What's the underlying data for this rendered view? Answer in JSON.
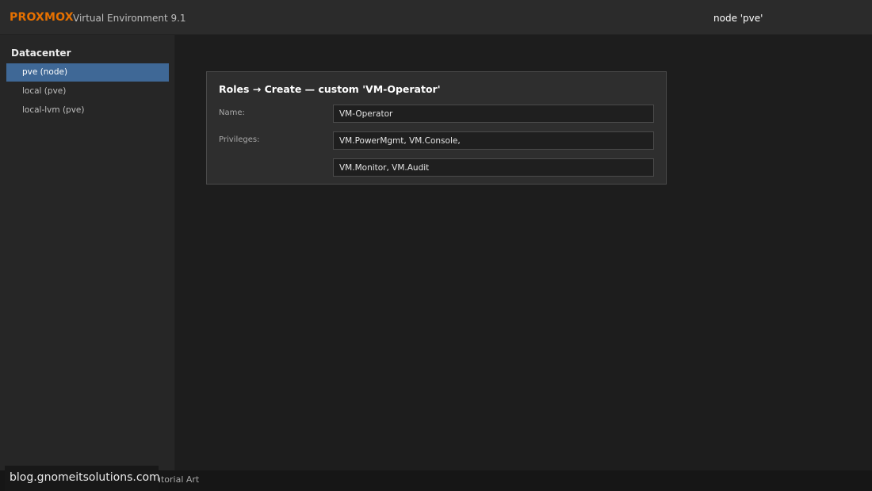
{
  "header": {
    "brand": "PROXMOX",
    "product": "Virtual Environment 9.1",
    "node": "node 'pve'"
  },
  "sidebar": {
    "title": "Datacenter",
    "items": [
      {
        "label": "pve (node)",
        "selected": true
      },
      {
        "label": "local (pve)",
        "selected": false
      },
      {
        "label": "local-lvm (pve)",
        "selected": false
      }
    ]
  },
  "dialog": {
    "title": "Roles → Create — custom 'VM-Operator'",
    "name_label": "Name:",
    "name_value": "VM-Operator",
    "privileges_label": "Privileges:",
    "privileges_line1": "VM.PowerMgmt, VM.Console,",
    "privileges_line2": "VM.Monitor, VM.Audit"
  },
  "footer": {
    "text": "utorial Art"
  },
  "watermark": {
    "text": "blog.gnomeitsolutions.com"
  },
  "colors": {
    "brand": "#e57000",
    "selected": "#3f6896",
    "background": "#1d1d1d"
  }
}
